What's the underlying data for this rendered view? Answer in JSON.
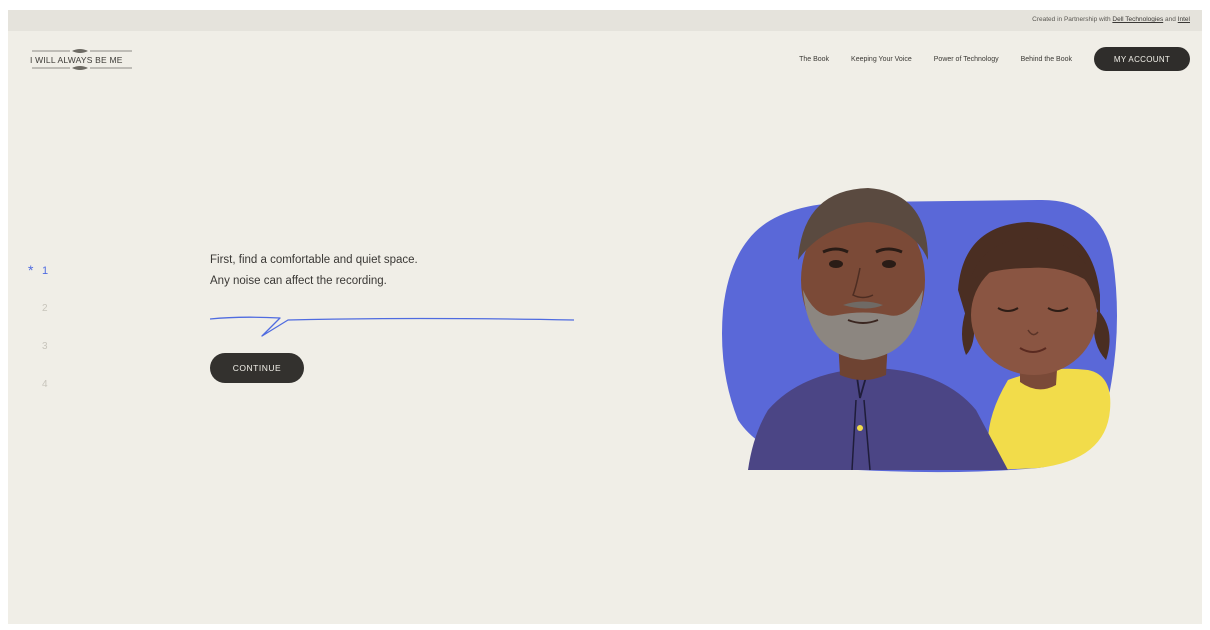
{
  "topbar": {
    "partner_prefix": "Created in Partnership with",
    "partner_link_1": "Dell Technologies",
    "partner_and": "and",
    "partner_link_2": "Intel"
  },
  "logo": {
    "text": "I WILL ALWAYS BE ME"
  },
  "nav": {
    "items": [
      "The Book",
      "Keeping Your Voice",
      "Power of Technology",
      "Behind the Book"
    ],
    "account_label": "MY ACCOUNT"
  },
  "steps": {
    "active_marker": "*",
    "items": [
      "1",
      "2",
      "3",
      "4"
    ],
    "active_index": 0
  },
  "main": {
    "line_1": "First, find a comfortable and quiet space.",
    "line_2": "Any noise can affect the recording.",
    "continue_label": "CONTINUE"
  },
  "colors": {
    "accent_blue": "#4f6be0",
    "dark_button": "#2f2d2b",
    "background": "#f0eee7",
    "illustration_blue": "#5a68d8",
    "shirt_yellow": "#f2dc4a"
  },
  "icons": {
    "step_marker": "asterisk-icon"
  }
}
